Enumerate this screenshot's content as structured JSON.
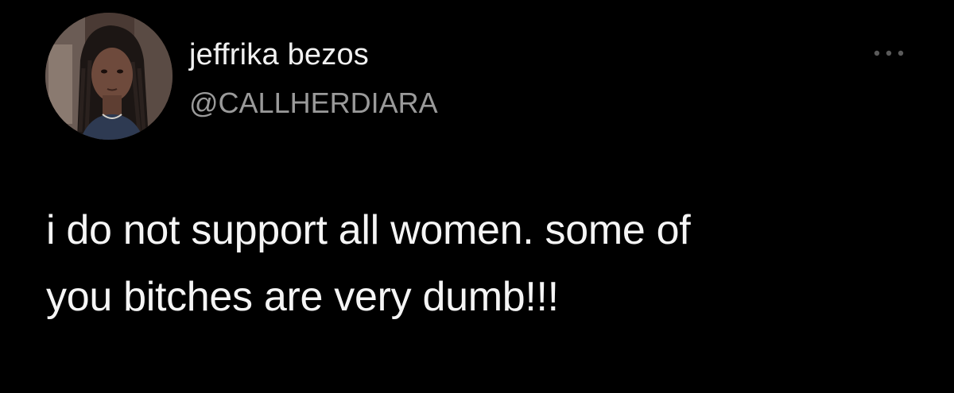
{
  "tweet": {
    "author": {
      "display_name": "jeffrika bezos",
      "handle": "@CALLHERDIARA",
      "avatar_icon": "profile-photo"
    },
    "more_icon": "ellipsis-horizontal-icon",
    "text_lines": [
      "i do not support all women. some of",
      "you bitches are very dumb!!!"
    ]
  },
  "colors": {
    "background": "#000000",
    "display_name": "#f1f1f1",
    "handle": "#9a9a9a",
    "text": "#f5f5f5",
    "more_icon": "#5a5a5a"
  }
}
